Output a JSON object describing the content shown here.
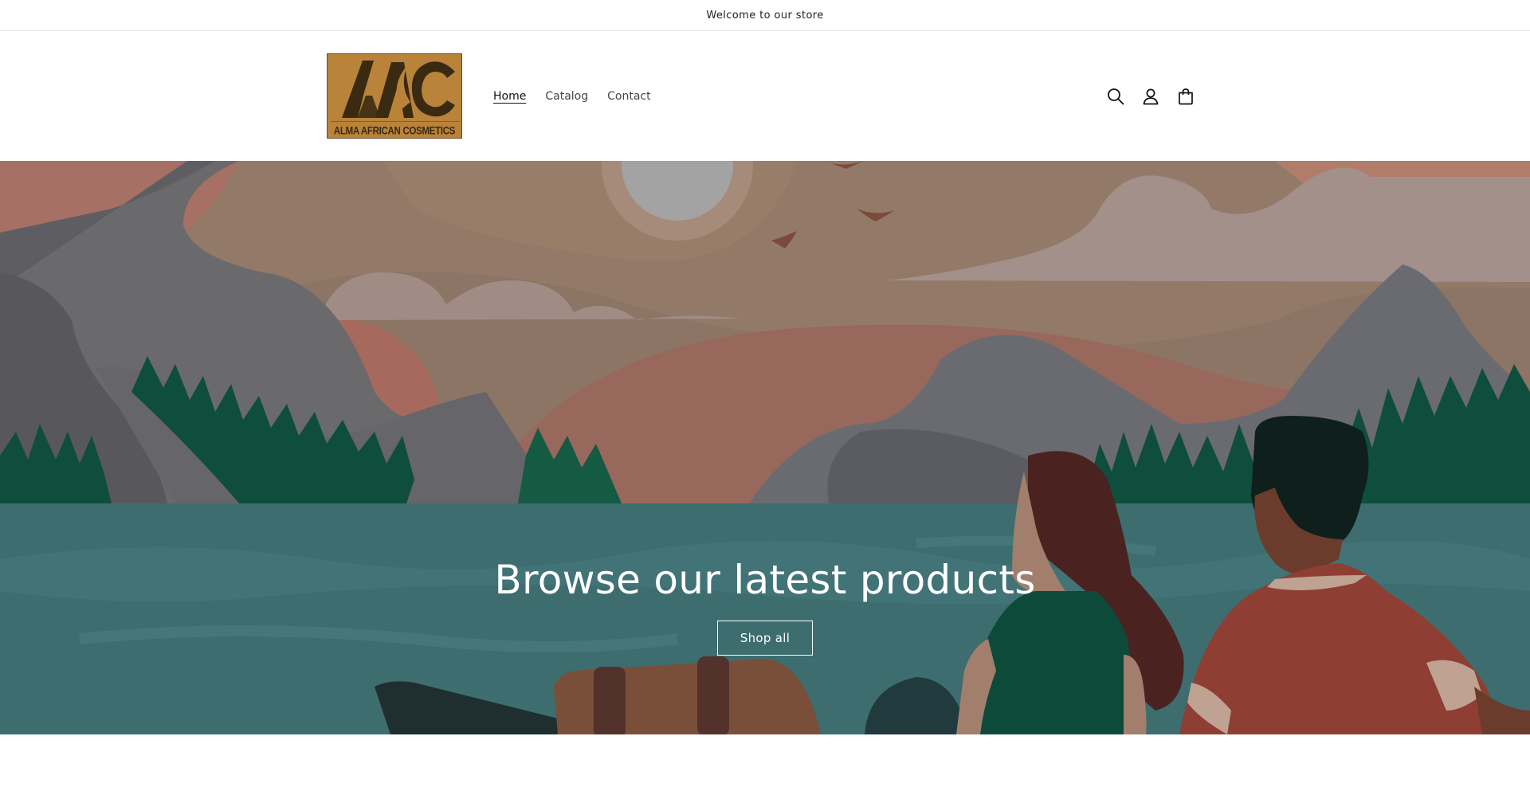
{
  "announcement": {
    "text": "Welcome to our store"
  },
  "brand": {
    "logo_text": "ALMA AFRICAN COSMETICS",
    "logo_initials": "AAC",
    "logo_bg": "#b9833a"
  },
  "nav": {
    "items": [
      {
        "label": "Home",
        "active": true
      },
      {
        "label": "Catalog",
        "active": false
      },
      {
        "label": "Contact",
        "active": false
      }
    ]
  },
  "header_icons": [
    "search-icon",
    "account-icon",
    "cart-icon"
  ],
  "hero": {
    "title": "Browse our latest products",
    "button_label": "Shop all",
    "colors": {
      "water": "#3d6d6f",
      "sky": "#8b7464",
      "mountain": "#6a6a6d",
      "trees": "#0f4d3c"
    }
  }
}
